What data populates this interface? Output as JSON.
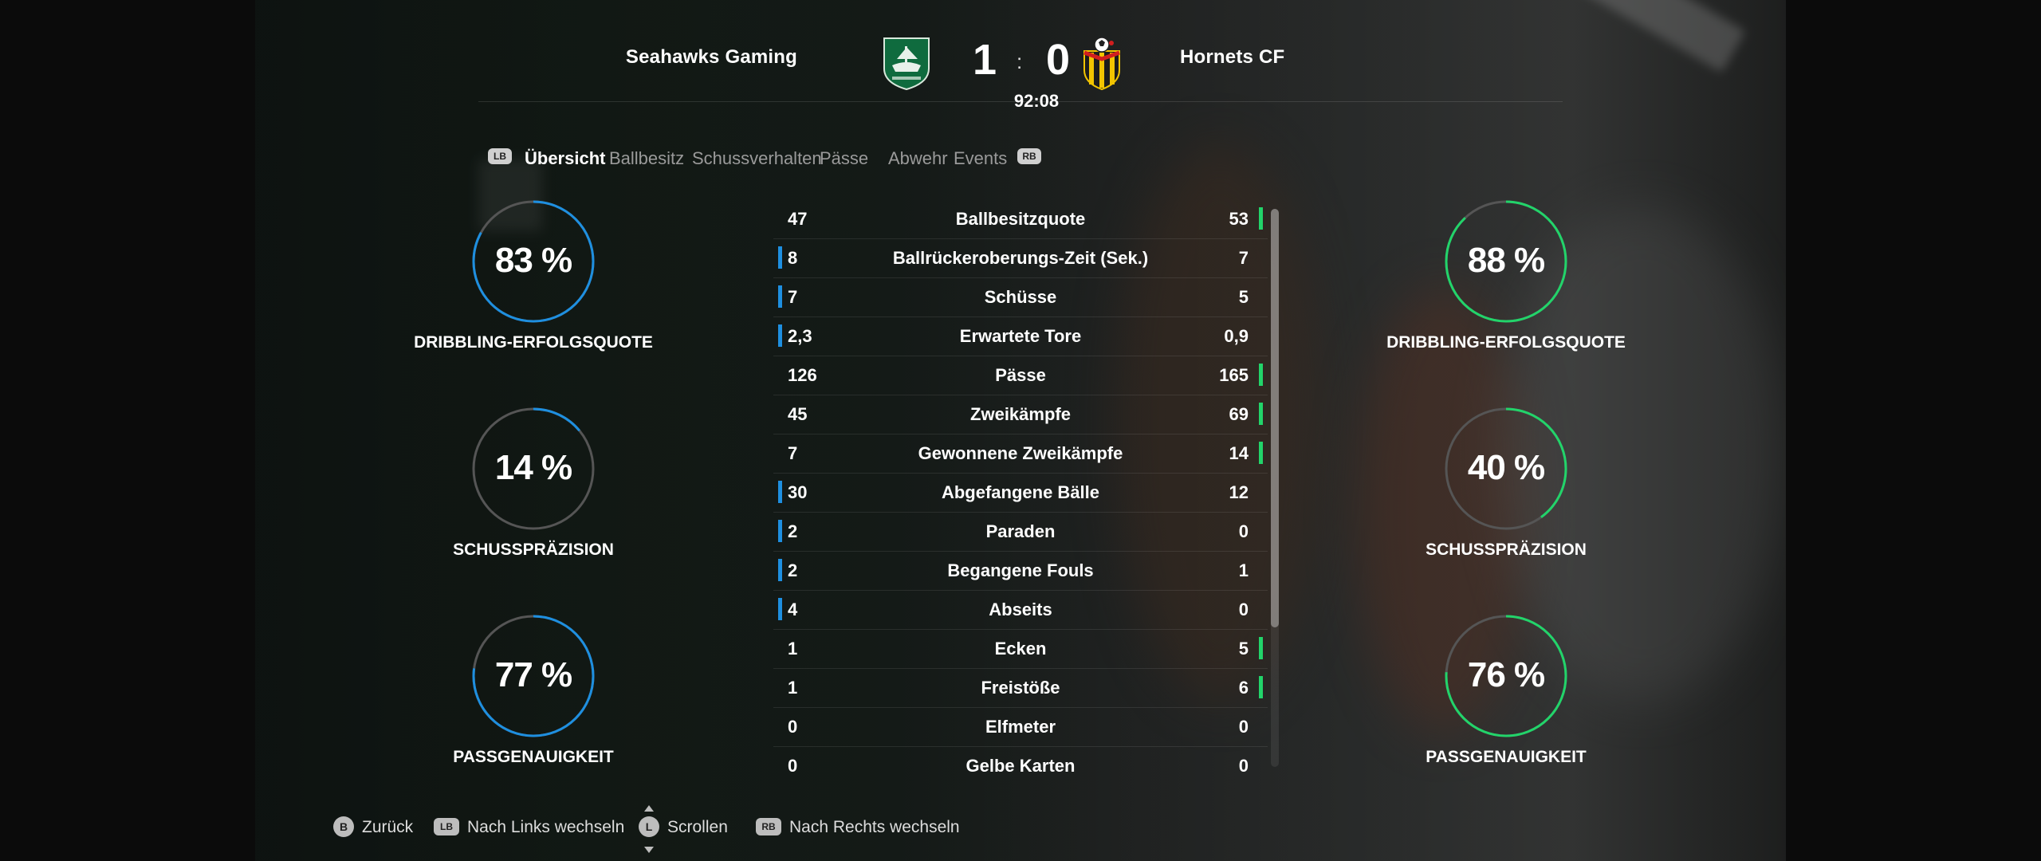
{
  "header": {
    "home_team": "Seahawks Gaming",
    "away_team": "Hornets CF",
    "home_score": "1",
    "away_score": "0",
    "separator": ":",
    "clock": "92:08",
    "home_color": "#1e8fe0",
    "away_color": "#22d46a"
  },
  "tabs": {
    "left_badge": "LB",
    "right_badge": "RB",
    "items": [
      {
        "label": "Übersicht",
        "active": true
      },
      {
        "label": "Ballbesitz",
        "active": false
      },
      {
        "label": "Schussverhalten",
        "active": false
      },
      {
        "label": "Pässe",
        "active": false
      },
      {
        "label": "Abwehr",
        "active": false
      },
      {
        "label": "Events",
        "active": false
      }
    ]
  },
  "home_rings": [
    {
      "value": "83 %",
      "percent": 83,
      "label": "DRIBBLING-ERFOLGSQUOTE"
    },
    {
      "value": "14 %",
      "percent": 14,
      "label": "SCHUSSPRÄZISION"
    },
    {
      "value": "77 %",
      "percent": 77,
      "label": "PASSGENAUIGKEIT"
    }
  ],
  "away_rings": [
    {
      "value": "88 %",
      "percent": 88,
      "label": "DRIBBLING-ERFOLGSQUOTE"
    },
    {
      "value": "40 %",
      "percent": 40,
      "label": "SCHUSSPRÄZISION"
    },
    {
      "value": "76 %",
      "percent": 76,
      "label": "PASSGENAUIGKEIT"
    }
  ],
  "stats": [
    {
      "home": "47",
      "name": "Ballbesitzquote",
      "away": "53",
      "leader": "away"
    },
    {
      "home": "8",
      "name": "Ballrückeroberungs-Zeit (Sek.)",
      "away": "7",
      "leader": "home"
    },
    {
      "home": "7",
      "name": "Schüsse",
      "away": "5",
      "leader": "home"
    },
    {
      "home": "2,3",
      "name": "Erwartete Tore",
      "away": "0,9",
      "leader": "home"
    },
    {
      "home": "126",
      "name": "Pässe",
      "away": "165",
      "leader": "away"
    },
    {
      "home": "45",
      "name": "Zweikämpfe",
      "away": "69",
      "leader": "away"
    },
    {
      "home": "7",
      "name": "Gewonnene Zweikämpfe",
      "away": "14",
      "leader": "away"
    },
    {
      "home": "30",
      "name": "Abgefangene Bälle",
      "away": "12",
      "leader": "home"
    },
    {
      "home": "2",
      "name": "Paraden",
      "away": "0",
      "leader": "home"
    },
    {
      "home": "2",
      "name": "Begangene Fouls",
      "away": "1",
      "leader": "home"
    },
    {
      "home": "4",
      "name": "Abseits",
      "away": "0",
      "leader": "home"
    },
    {
      "home": "1",
      "name": "Ecken",
      "away": "5",
      "leader": "away"
    },
    {
      "home": "1",
      "name": "Freistöße",
      "away": "6",
      "leader": "away"
    },
    {
      "home": "0",
      "name": "Elfmeter",
      "away": "0",
      "leader": "none"
    },
    {
      "home": "0",
      "name": "Gelbe Karten",
      "away": "0",
      "leader": "none"
    }
  ],
  "footer": [
    {
      "button": "B",
      "label": "Zurück"
    },
    {
      "button": "LB",
      "label": "Nach Links wechseln"
    },
    {
      "button": "L",
      "label": "Scrollen"
    },
    {
      "button": "RB",
      "label": "Nach Rechts wechseln"
    }
  ]
}
